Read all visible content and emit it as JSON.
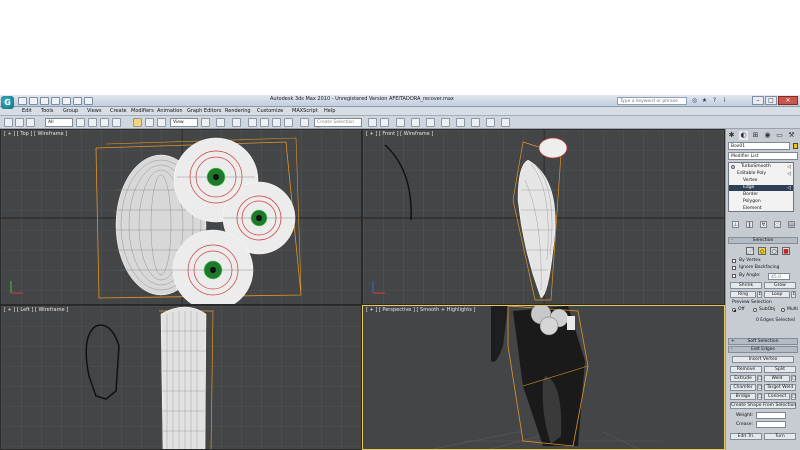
{
  "window": {
    "title": "Autodesk 3ds Max 2010  -  Unregistered Version    AFEITADORA_recover.max",
    "search_placeholder": "Type a keyword or phrase",
    "minimize": "–",
    "maximize": "□",
    "close": "✕"
  },
  "menu": [
    "Edit",
    "Tools",
    "Group",
    "Views",
    "Create",
    "Modifiers",
    "Animation",
    "Graph Editors",
    "Rendering",
    "Customize",
    "MAXScript",
    "Help"
  ],
  "toolbar": {
    "filter_value": "All",
    "refcoord_value": "View",
    "named_sel_placeholder": "Create Selection Se"
  },
  "viewports": {
    "top": "[ + ] [ Top ] [ Wireframe ]",
    "front": "[ + ] [ Front ] [ Wireframe ]",
    "left": "[ + ] [ Left ] [ Wireframe ]",
    "perspective": "[ + ] [ Perspective ] [ Smooth + Highlights ]"
  },
  "panel": {
    "object_name": "Box01",
    "modifier_list": "Modifier List",
    "stack": [
      {
        "label": "TurboSmooth",
        "indent": 1
      },
      {
        "label": "Editable Poly",
        "indent": 0
      },
      {
        "label": "Vertex",
        "indent": 2
      },
      {
        "label": "Edge",
        "indent": 2,
        "selected": true
      },
      {
        "label": "Border",
        "indent": 2
      },
      {
        "label": "Polygon",
        "indent": 2
      },
      {
        "label": "Element",
        "indent": 2
      }
    ],
    "selection": {
      "title": "Selection",
      "by_vertex": "By Vertex",
      "ignore_backfacing": "Ignore Backfacing",
      "by_angle": "By Angle:",
      "by_angle_value": "45.0",
      "shrink": "Shrink",
      "grow": "Grow",
      "ring": "Ring",
      "loop": "Loop",
      "preview_selection": "Preview Selection",
      "off": "Off",
      "subobj": "SubObj",
      "multi": "Multi",
      "status": "0 Edges Selected"
    },
    "soft_selection": "Soft Selection",
    "edit_edges": {
      "title": "Edit Edges",
      "insert_vertex": "Insert Vertex",
      "remove": "Remove",
      "split": "Split",
      "extrude": "Extrude",
      "weld": "Weld",
      "chamfer": "Chamfer",
      "target_weld": "Target Weld",
      "bridge": "Bridge",
      "connect": "Connect",
      "create_shape": "Create Shape From Selection",
      "weight": "Weight:",
      "crease": "Crease:",
      "edit_tri": "Edit Tri.",
      "turn": "Turn"
    }
  }
}
